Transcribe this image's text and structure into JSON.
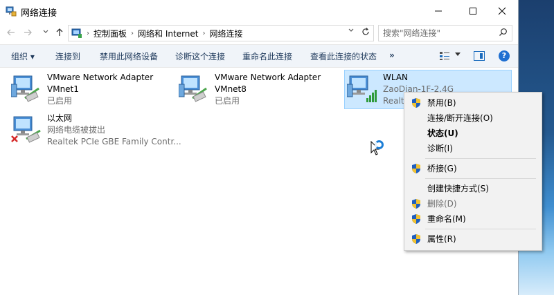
{
  "window": {
    "title": "网络连接"
  },
  "nav": {
    "breadcrumb": [
      "控制面板",
      "网络和 Internet",
      "网络连接"
    ],
    "search_placeholder": "搜索\"网络连接\""
  },
  "cmdbar": {
    "organize": "组织 ▾",
    "items": [
      "连接到",
      "禁用此网络设备",
      "诊断这个连接",
      "重命名此连接",
      "查看此连接的状态"
    ],
    "more": "»"
  },
  "connections": [
    {
      "name": "VMware Network Adapter",
      "line2": "VMnet1",
      "line3": "已启用"
    },
    {
      "name": "VMware Network Adapter",
      "line2": "VMnet8",
      "line3": "已启用"
    },
    {
      "name": "WLAN",
      "line2": "ZaoDian-1F-2.4G",
      "line3": "Realte"
    },
    {
      "name": "以太网",
      "line2": "网络电缆被拔出",
      "line3": "Realtek PCIe GBE Family Contr..."
    }
  ],
  "context_menu": {
    "items": [
      {
        "label": "禁用(B)"
      },
      {
        "label": "连接/断开连接(O)"
      },
      {
        "label": "状态(U)"
      },
      {
        "label": "诊断(I)"
      },
      {
        "label": "桥接(G)"
      },
      {
        "label": "创建快捷方式(S)"
      },
      {
        "label": "删除(D)"
      },
      {
        "label": "重命名(M)"
      },
      {
        "label": "属性(R)"
      }
    ]
  },
  "colors": {
    "selection": "#cce8ff",
    "accent": "#1f6fd1",
    "command_text": "#1e395b"
  }
}
